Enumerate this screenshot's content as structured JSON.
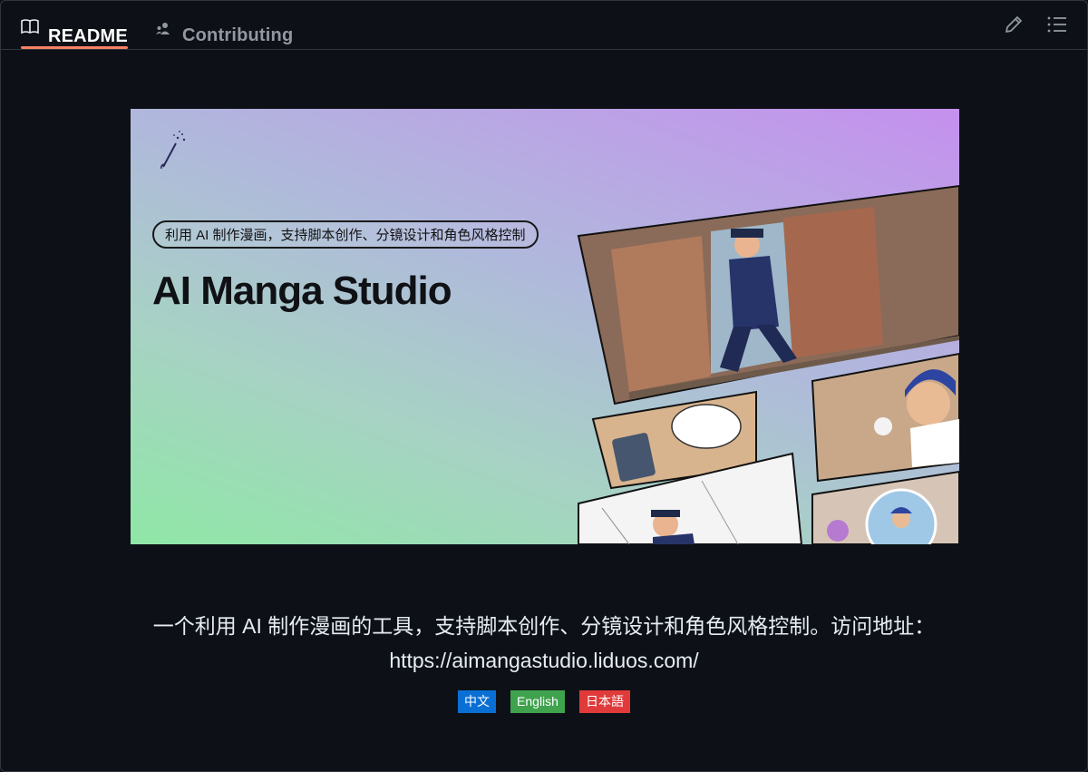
{
  "tabs": [
    {
      "label": "README",
      "icon": "book-icon",
      "active": true
    },
    {
      "label": "Contributing",
      "icon": "people-icon",
      "active": false
    }
  ],
  "toolbar": {
    "edit_icon": "pencil-icon",
    "toc_icon": "list-icon"
  },
  "banner": {
    "tagline": "利用 AI 制作漫画，支持脚本创作、分镜设计和角色风格控制",
    "title": "AI Manga Studio"
  },
  "description": {
    "line1": "一个利用 AI 制作漫画的工具，支持脚本创作、分镜设计和角色风格控制。访问地址：",
    "line2": "https://aimangastudio.liduos.com/"
  },
  "badges": [
    {
      "label": "中文",
      "color": "#0a6fd4"
    },
    {
      "label": "English",
      "color": "#3fa34d"
    },
    {
      "label": "日本語",
      "color": "#e03a3a"
    }
  ],
  "colors": {
    "background": "#0d1117",
    "border": "#30363d",
    "active_tab_underline": "#f78166"
  }
}
